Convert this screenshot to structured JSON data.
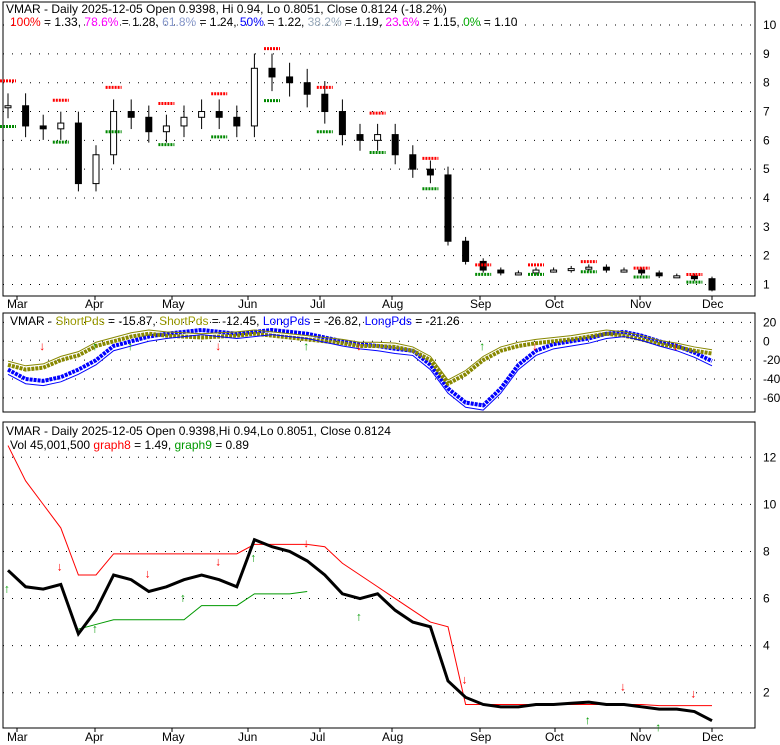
{
  "chart_data": [
    {
      "type": "candlestick",
      "title": "VMAR - Daily 2025-12-05 Open 0.9398, Hi 0.94, Lo 0.8051, Close 0.8124 (-18.2%)",
      "legend": [
        {
          "label": "100%",
          "value": "= 1.33, ",
          "color": "#ff0000"
        },
        {
          "label": "78.6%",
          "value": "= 1.28, ",
          "color": "#ff00ff"
        },
        {
          "label": "61.8%",
          "value": "= 1.24, ",
          "color": "#8899cc"
        },
        {
          "label": "50%",
          "value": "= 1.22, ",
          "color": "#0000ff"
        },
        {
          "label": "38.2%",
          "value": "= 1.19, ",
          "color": "#99aabb"
        },
        {
          "label": "23.6%",
          "value": "= 1.15, ",
          "color": "#ff00ff"
        },
        {
          "label": "0%",
          "value": "= 1.10",
          "color": "#00aa00"
        }
      ],
      "yticks": [
        1,
        2,
        3,
        4,
        5,
        6,
        7,
        8,
        9,
        10
      ],
      "ylim": [
        0.6,
        10.8
      ],
      "months": [
        "Mar",
        "Apr",
        "May",
        "Jun",
        "Jul",
        "Aug",
        "Sep",
        "Oct",
        "Nov",
        "Dec"
      ],
      "close": [
        7.2,
        6.5,
        6.4,
        6.6,
        4.5,
        5.5,
        7.0,
        6.8,
        6.3,
        6.5,
        6.8,
        7.0,
        6.8,
        6.5,
        8.5,
        8.2,
        8.0,
        7.6,
        7.0,
        6.2,
        6.0,
        6.2,
        5.5,
        5.0,
        4.8,
        2.5,
        1.8,
        1.5,
        1.4,
        1.4,
        1.5,
        1.5,
        1.55,
        1.6,
        1.5,
        1.5,
        1.4,
        1.3,
        1.3,
        1.2,
        0.81
      ]
    },
    {
      "type": "line",
      "title_parts": [
        {
          "label": "VMAR - ",
          "color": "#000000"
        },
        {
          "label": "ShortPds",
          "color": "#999900"
        },
        {
          "label": " = -15.87, ",
          "color": "#000000"
        },
        {
          "label": "ShortPds",
          "color": "#999900"
        },
        {
          "label": " = -12.45, ",
          "color": "#000000"
        },
        {
          "label": "LongPds",
          "color": "#0000ff"
        },
        {
          "label": " = -26.82, ",
          "color": "#000000"
        },
        {
          "label": "LongPds",
          "color": "#0000ff"
        },
        {
          "label": " = -21.26",
          "color": "#000000"
        }
      ],
      "yticks": [
        20,
        0,
        -20,
        -40,
        -60
      ],
      "ylim": [
        -75,
        30
      ],
      "long": [
        -30,
        -40,
        -42,
        -38,
        -30,
        -20,
        -5,
        0,
        5,
        8,
        10,
        12,
        10,
        8,
        10,
        12,
        10,
        8,
        4,
        0,
        -3,
        -5,
        -8,
        -10,
        -25,
        -50,
        -65,
        -68,
        -50,
        -25,
        -10,
        -3,
        0,
        3,
        8,
        10,
        6,
        0,
        -5,
        -12,
        -21
      ],
      "short": [
        -25,
        -30,
        -28,
        -20,
        -15,
        -5,
        0,
        5,
        8,
        6,
        5,
        4,
        5,
        6,
        8,
        6,
        4,
        2,
        0,
        -2,
        -5,
        -5,
        -6,
        -10,
        -20,
        -45,
        -35,
        -20,
        -10,
        -5,
        -2,
        0,
        2,
        5,
        8,
        6,
        2,
        -3,
        -6,
        -10,
        -13
      ]
    },
    {
      "type": "line",
      "title": "VMAR - Daily 2025-12-05 Open 0.9398,Hi 0.94,Lo 0.8051, Close 0.8124",
      "vol_label": "Vol 45,001,500 ",
      "g8_label": "graph8",
      "g8_value": " = 1.49, ",
      "g9_label": "graph9",
      "g9_value": " = 0.89",
      "yticks": [
        2,
        4,
        6,
        8,
        10,
        12
      ],
      "ylim": [
        0.5,
        13.5
      ],
      "graph8": [
        12.5,
        11,
        10,
        9,
        7,
        7,
        7.9,
        7.9,
        7.9,
        7.9,
        7.9,
        7.9,
        7.9,
        7.9,
        8.3,
        8.3,
        8.3,
        8.3,
        8.2,
        7.5,
        7,
        6.5,
        6,
        5.5,
        5,
        4.8,
        1.5,
        1.5,
        1.5,
        1.5,
        1.5,
        1.5,
        1.5,
        1.5,
        1.5,
        1.5,
        1.5,
        1.45,
        1.45,
        1.45,
        1.45
      ],
      "graph9": [
        null,
        null,
        null,
        null,
        4.7,
        4.9,
        5.1,
        5.1,
        5.1,
        5.1,
        5.1,
        5.7,
        5.7,
        5.7,
        6.2,
        6.2,
        6.2,
        6.3,
        null,
        null,
        null,
        null,
        null,
        null,
        null,
        null,
        null,
        null,
        null,
        null,
        null,
        null,
        null,
        null,
        null,
        null,
        null,
        null,
        null,
        null,
        null
      ]
    }
  ]
}
